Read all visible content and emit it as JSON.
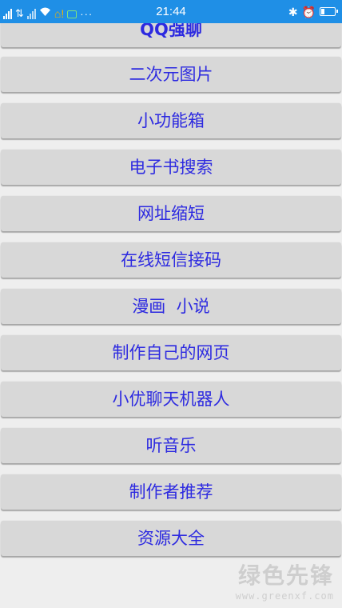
{
  "status_bar": {
    "time": "21:44",
    "more_dots": "···",
    "colors": {
      "background": "#1f8fe6",
      "foreground": "#ffffff"
    },
    "battery_level": 0.25
  },
  "menu": {
    "text_color": "#2d2ae0",
    "button_color": "#d8d8d8",
    "items": [
      {
        "label": "QQ强聊"
      },
      {
        "label": "二次元图片"
      },
      {
        "label": "小功能箱"
      },
      {
        "label": "电子书搜索"
      },
      {
        "label": "网址缩短"
      },
      {
        "label": "在线短信接码"
      },
      {
        "label": "漫画  小说"
      },
      {
        "label": "制作自己的网页"
      },
      {
        "label": "小优聊天机器人"
      },
      {
        "label": "听音乐"
      },
      {
        "label": "制作者推荐"
      },
      {
        "label": "资源大全"
      }
    ]
  },
  "watermark": {
    "main": "绿色先锋",
    "sub": "www.greenxf.com"
  }
}
